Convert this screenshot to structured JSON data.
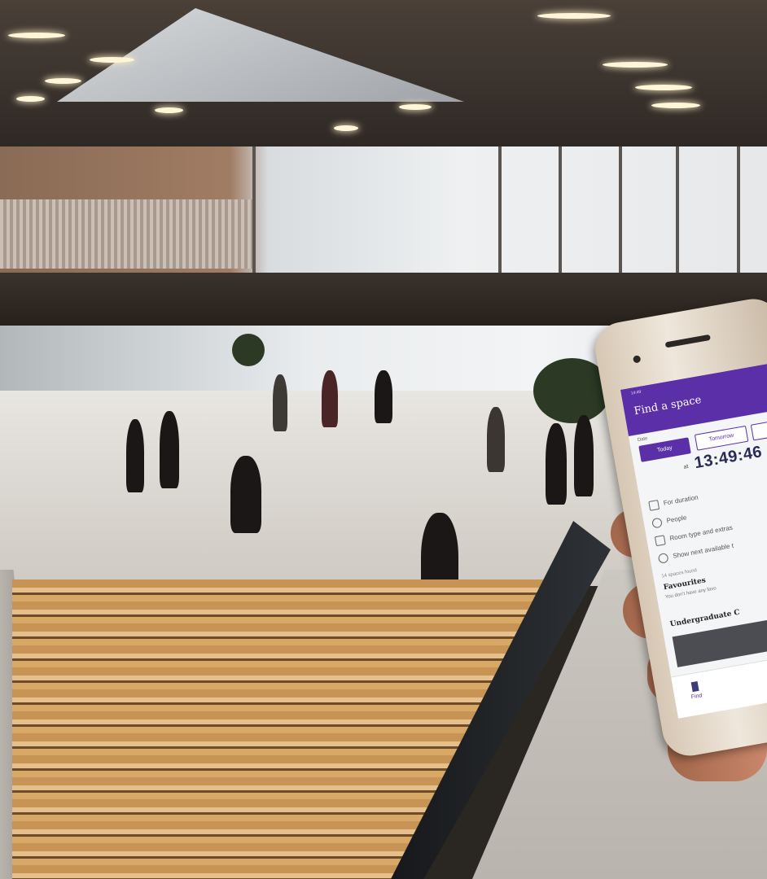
{
  "app": {
    "title": "Find a space",
    "status_bar": "14:49"
  },
  "date_picker": {
    "label": "Date",
    "today_label": "Today",
    "tomorrow_label": "Tomorrow",
    "at_label": "at",
    "time_value": "13:49:46"
  },
  "filters": [
    {
      "label": "For duration",
      "icon": "hourglass-icon"
    },
    {
      "label": "People",
      "icon": "people-icon"
    },
    {
      "label": "Room type and extras",
      "icon": "room-icon"
    },
    {
      "label": "Show next available t",
      "icon": "clock-icon"
    }
  ],
  "results": {
    "found_text": "14 spaces found",
    "favourites_title": "Favourites",
    "favourites_subtitle": "You don't have any favo",
    "section_title": "Undergraduate C"
  },
  "tabbar": {
    "find_label": "Find"
  },
  "colors": {
    "accent": "#5b2fa8",
    "time_text": "#2b2b57"
  }
}
